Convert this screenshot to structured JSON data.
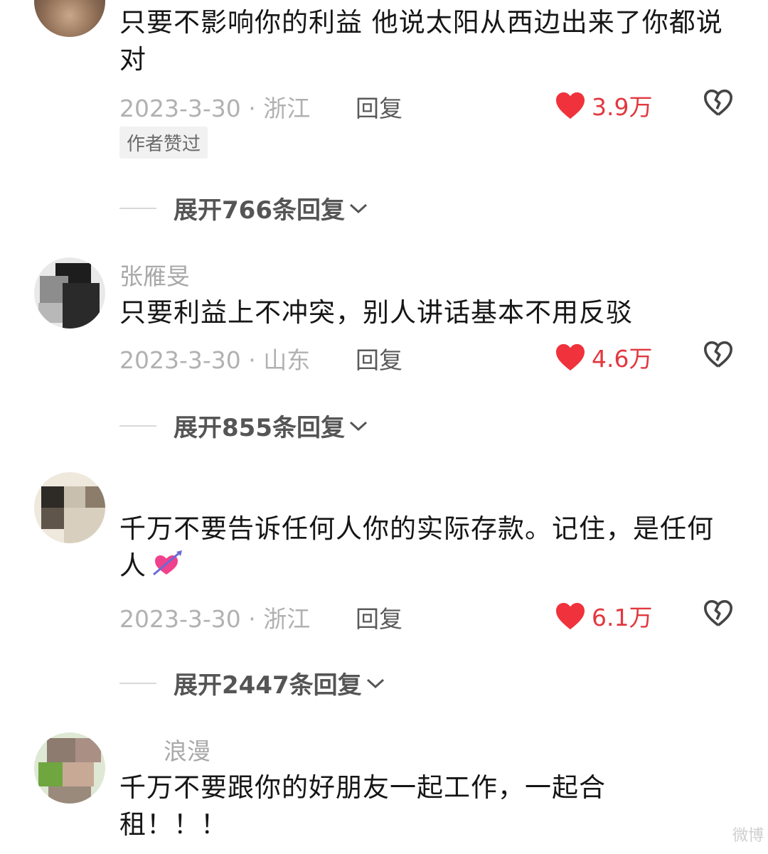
{
  "comments": [
    {
      "username": "",
      "text": "只要不影响你的利益 他说太阳从西边出来了你都说对",
      "meta": "2023-3-30 · 浙江",
      "reply_label": "回复",
      "likes": "3.9万",
      "author_badge": "作者赞过",
      "expand_label": "展开766条回复"
    },
    {
      "username": "张雁旻",
      "text": "只要利益上不冲突，别人讲话基本不用反驳",
      "meta": "2023-3-30 · 山东",
      "reply_label": "回复",
      "likes": "4.6万",
      "expand_label": "展开855条回复"
    },
    {
      "username": "",
      "text": "千万不要告诉任何人你的实际存款。记住，是任何人",
      "meta": "2023-3-30 · 浙江",
      "reply_label": "回复",
      "likes": "6.1万",
      "expand_label": "展开2447条回复"
    },
    {
      "username": "浪漫",
      "text": "千万不要跟你的好朋友一起工作，一起合租！！！"
    }
  ],
  "icons": {
    "like": "heart-icon",
    "dislike": "broken-heart-icon",
    "expand": "chevron-down-icon",
    "emoji": "heart-with-arrow-emoji"
  },
  "colors": {
    "like": "#f0323c",
    "like_count": "#e2383f",
    "meta": "#b1b1b1",
    "text": "#161616"
  },
  "watermark": "微博"
}
